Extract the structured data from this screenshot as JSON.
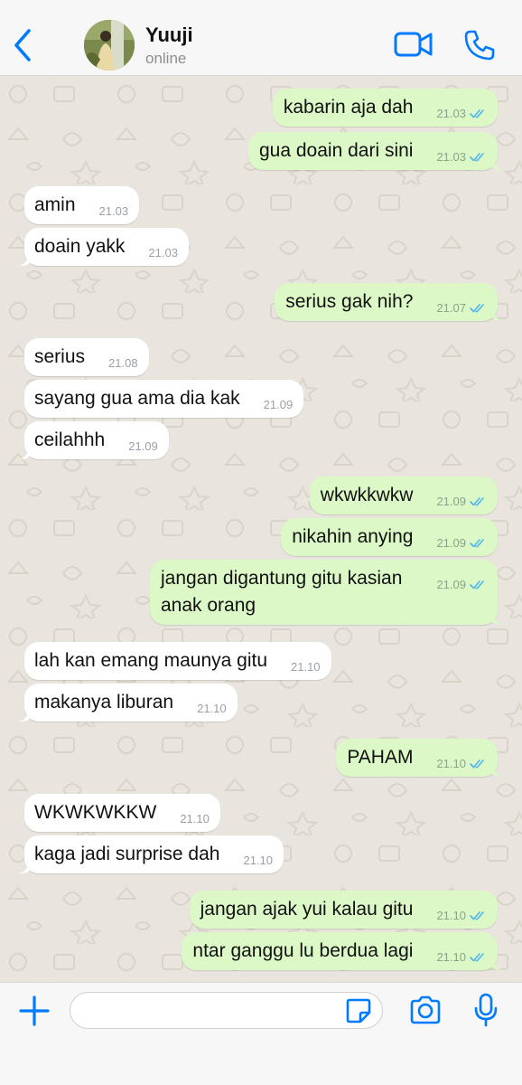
{
  "header": {
    "contact_name": "Yuuji",
    "status": "online",
    "icons": [
      "back-chevron-icon",
      "avatar",
      "video-camera-icon",
      "phone-icon"
    ]
  },
  "colors": {
    "accent": "#007aff",
    "outgoing_bubble": "#dcf8c6",
    "incoming_bubble": "#ffffff",
    "wallpaper": "#e9e5de",
    "read_ticks": "#4fb6ec"
  },
  "messages": [
    {
      "dir": "out",
      "text": "kabarin aja dah",
      "time": "21.03"
    },
    {
      "dir": "out",
      "text": "gua doain dari sini",
      "time": "21.03"
    },
    {
      "dir": "in",
      "text": "amin",
      "time": "21.03"
    },
    {
      "dir": "in",
      "text": "doain yakk",
      "time": "21.03"
    },
    {
      "dir": "out",
      "text": "serius gak nih?",
      "time": "21.07"
    },
    {
      "dir": "in",
      "text": "serius",
      "time": "21.08"
    },
    {
      "dir": "in",
      "text": "sayang gua ama dia kak",
      "time": "21.09"
    },
    {
      "dir": "in",
      "text": "ceilahhh",
      "time": "21.09"
    },
    {
      "dir": "out",
      "text": "wkwkkwkw",
      "time": "21.09"
    },
    {
      "dir": "out",
      "text": "nikahin anying",
      "time": "21.09"
    },
    {
      "dir": "out",
      "text": "jangan digantung gitu kasian anak orang",
      "time": "21.09"
    },
    {
      "dir": "in",
      "text": "lah kan emang maunya gitu",
      "time": "21.10"
    },
    {
      "dir": "in",
      "text": "makanya liburan",
      "time": "21.10"
    },
    {
      "dir": "out",
      "text": "PAHAM",
      "time": "21.10"
    },
    {
      "dir": "in",
      "text": "WKWKWKKW",
      "time": "21.10"
    },
    {
      "dir": "in",
      "text": "kaga jadi surprise dah",
      "time": "21.10"
    },
    {
      "dir": "out",
      "text": "jangan ajak yui kalau gitu",
      "time": "21.10"
    },
    {
      "dir": "out",
      "text": "ntar ganggu lu berdua lagi",
      "time": "21.10"
    }
  ],
  "composer": {
    "value": "",
    "placeholder": "",
    "icons": [
      "plus-icon",
      "sticker-icon",
      "camera-icon",
      "microphone-icon"
    ]
  }
}
